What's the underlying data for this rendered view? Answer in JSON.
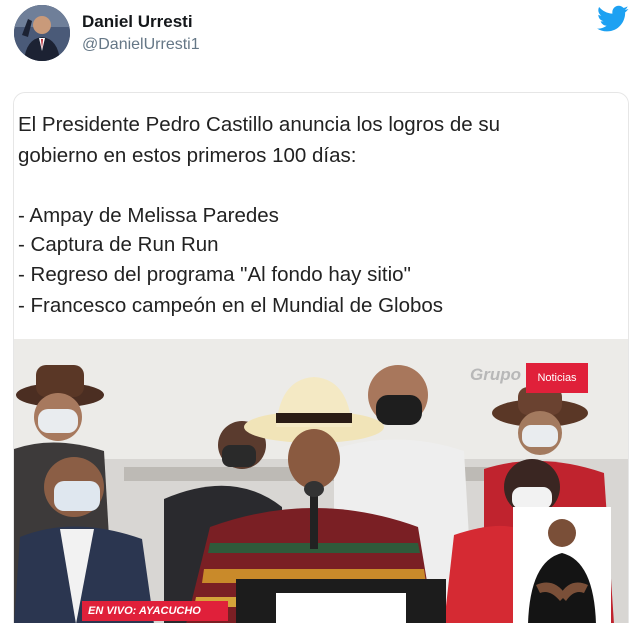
{
  "user": {
    "display_name": "Daniel Urresti",
    "handle": "@DanielUrresti1"
  },
  "icons": {
    "brand": "twitter-bird-icon",
    "brand_color": "#1da1f2"
  },
  "post": {
    "caption_lines": [
      "El Presidente Pedro Castillo anuncia los logros de su",
      "gobierno en estos primeros 100 días:",
      "- Ampay de Melissa Paredes",
      "- Captura de Run Run",
      "- Regreso del programa \"Al fondo hay sitio\"",
      "- Francesco campeón en el Mundial de Globos"
    ]
  },
  "broadcast": {
    "channel_logo": "Grupo",
    "channel_badge": "Noticias",
    "live_label": "EN VIVO: AYACUCHO",
    "accent_color": "#e0203a"
  }
}
